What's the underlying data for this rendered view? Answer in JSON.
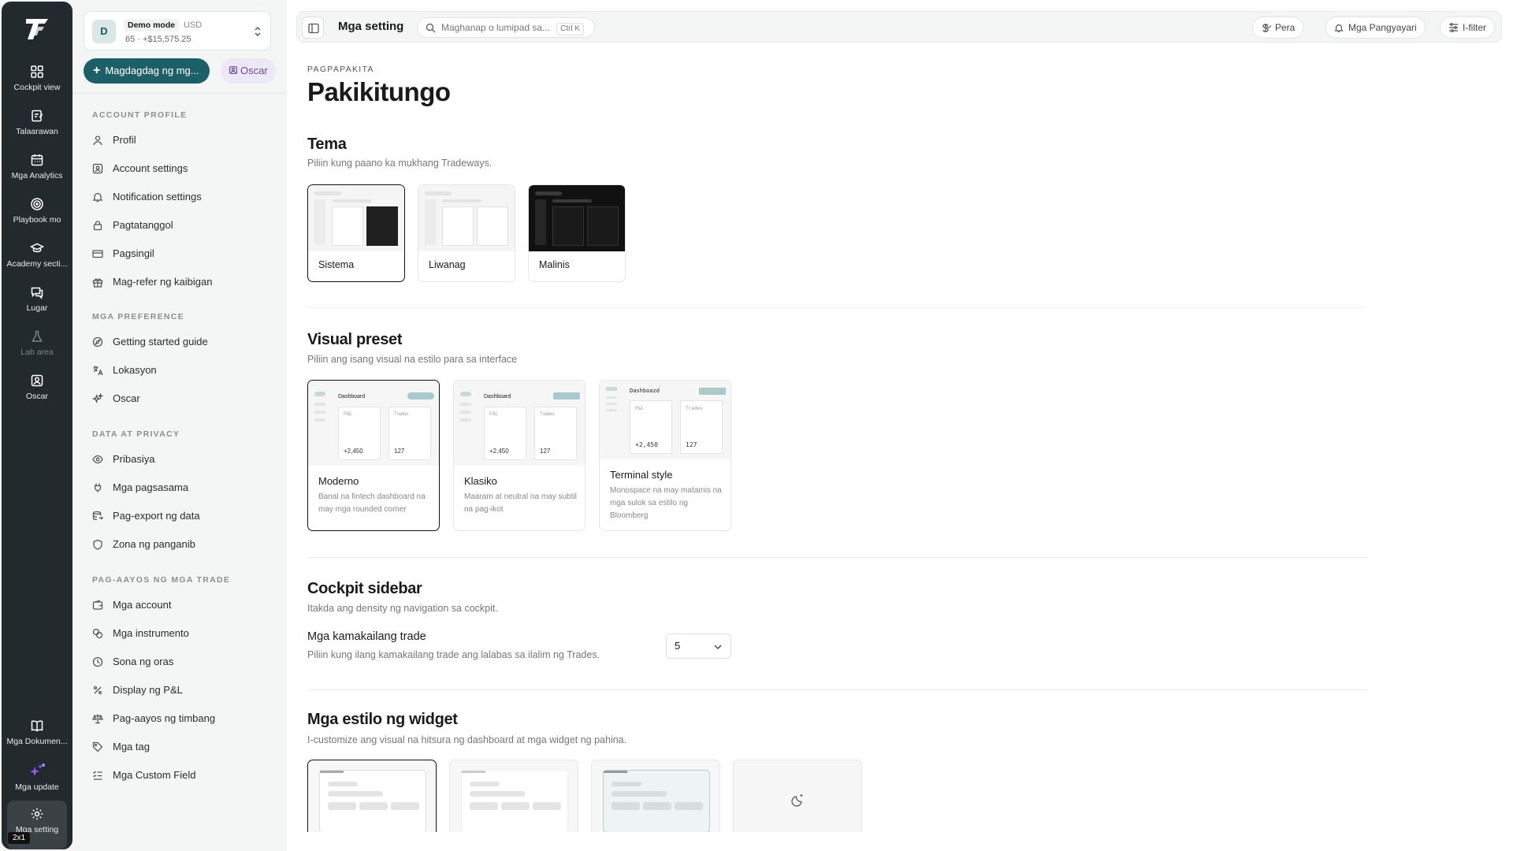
{
  "rail": {
    "items": [
      {
        "label": "Cockpit view",
        "icon": "grid-icon"
      },
      {
        "label": "Talaarawan",
        "icon": "journal-icon"
      },
      {
        "label": "Mga Analytics",
        "icon": "calendar-icon"
      },
      {
        "label": "Playbook mo",
        "icon": "target-icon"
      },
      {
        "label": "Academy secti...",
        "icon": "graduation-cap-icon"
      },
      {
        "label": "Lugar",
        "icon": "chat-icon"
      },
      {
        "label": "Lab area",
        "icon": "flask-icon"
      },
      {
        "label": "Oscar",
        "icon": "user-square-icon"
      }
    ],
    "bottom": [
      {
        "label": "Mga Dokumen...",
        "icon": "book-icon"
      },
      {
        "label": "Mga update",
        "icon": "sparkles-icon"
      },
      {
        "label": "Mga setting",
        "icon": "gear-icon"
      }
    ],
    "badge": "2x1"
  },
  "account": {
    "avatar": "D",
    "mode": "Demo mode",
    "currency": "USD",
    "balance": "65 · +$15,575.25"
  },
  "actions": {
    "add_label": "Magdagdag ng mg...",
    "oscar_label": "Oscar"
  },
  "sidebar": {
    "sections": [
      {
        "title": "ACCOUNT PROFILE",
        "items": [
          "Profil",
          "Account settings",
          "Notification settings",
          "Pagtatanggol",
          "Pagsingil",
          "Mag-refer ng kaibigan"
        ]
      },
      {
        "title": "MGA PREFERENCE",
        "items": [
          "Getting started guide",
          "Lokasyon",
          "Oscar"
        ]
      },
      {
        "title": "DATA AT PRIVACY",
        "items": [
          "Pribasiya",
          "Mga pagsasama",
          "Pag-export ng data",
          "Zona ng panganib"
        ]
      },
      {
        "title": "PAG-AAYOS NG MGA TRADE",
        "items": [
          "Mga account",
          "Mga instrumento",
          "Sona ng oras",
          "Display ng P&L",
          "Pag-aayos ng timbang",
          "Mga tag",
          "Mga Custom Field"
        ]
      }
    ]
  },
  "topbar": {
    "title": "Mga setting",
    "search_placeholder": "Maghanap o lumipad sa...",
    "shortcut": "Ctrl K",
    "currency_btn": "Pera",
    "events_btn": "Mga Pangyayari",
    "filter_btn": "I-filter"
  },
  "page": {
    "eyebrow": "PAGPAPAKITA",
    "title": "Pakikitungo"
  },
  "theme": {
    "title": "Tema",
    "desc": "Piliin kung paano ka mukhang Tradeways.",
    "options": [
      "Sistema",
      "Liwanag",
      "Malinis"
    ],
    "selected": "Sistema"
  },
  "preset": {
    "title": "Visual preset",
    "desc": "Piliin ang isang visual na estilo para sa interface",
    "preview": {
      "dashboard": "Dashboard",
      "terminal_dashboard": "Dashboazd",
      "pl": "P&L",
      "trades": "Trades",
      "pl_value": "+2,450",
      "trades_value": "127"
    },
    "options": [
      {
        "name": "Moderno",
        "desc": "Banal na fintech dashboard na may mga rounded corner"
      },
      {
        "name": "Klasiko",
        "desc": "Maaram at neutral na may subtil na pag-ikot"
      },
      {
        "name": "Terminal style",
        "desc": "Monospace na may matamis na mga sulok sa estilo ng Bloomberg"
      }
    ],
    "selected": "Moderno"
  },
  "cockpit": {
    "title": "Cockpit sidebar",
    "desc": "Itakda ang density ng navigation sa cockpit.",
    "field_label": "Mga kamakailang trade",
    "field_desc": "Piliin kung ilang kamakailang trade ang lalabas sa ilalim ng Trades.",
    "value": "5"
  },
  "widgets": {
    "title": "Mga estilo ng widget",
    "desc": "I-customize ang visual na hitsura ng dashboard at mga widget ng pahina."
  },
  "colors": {
    "brand": "#1c5f66",
    "rail_bg": "#232a2d",
    "oscar_accent": "#6b48a5"
  }
}
